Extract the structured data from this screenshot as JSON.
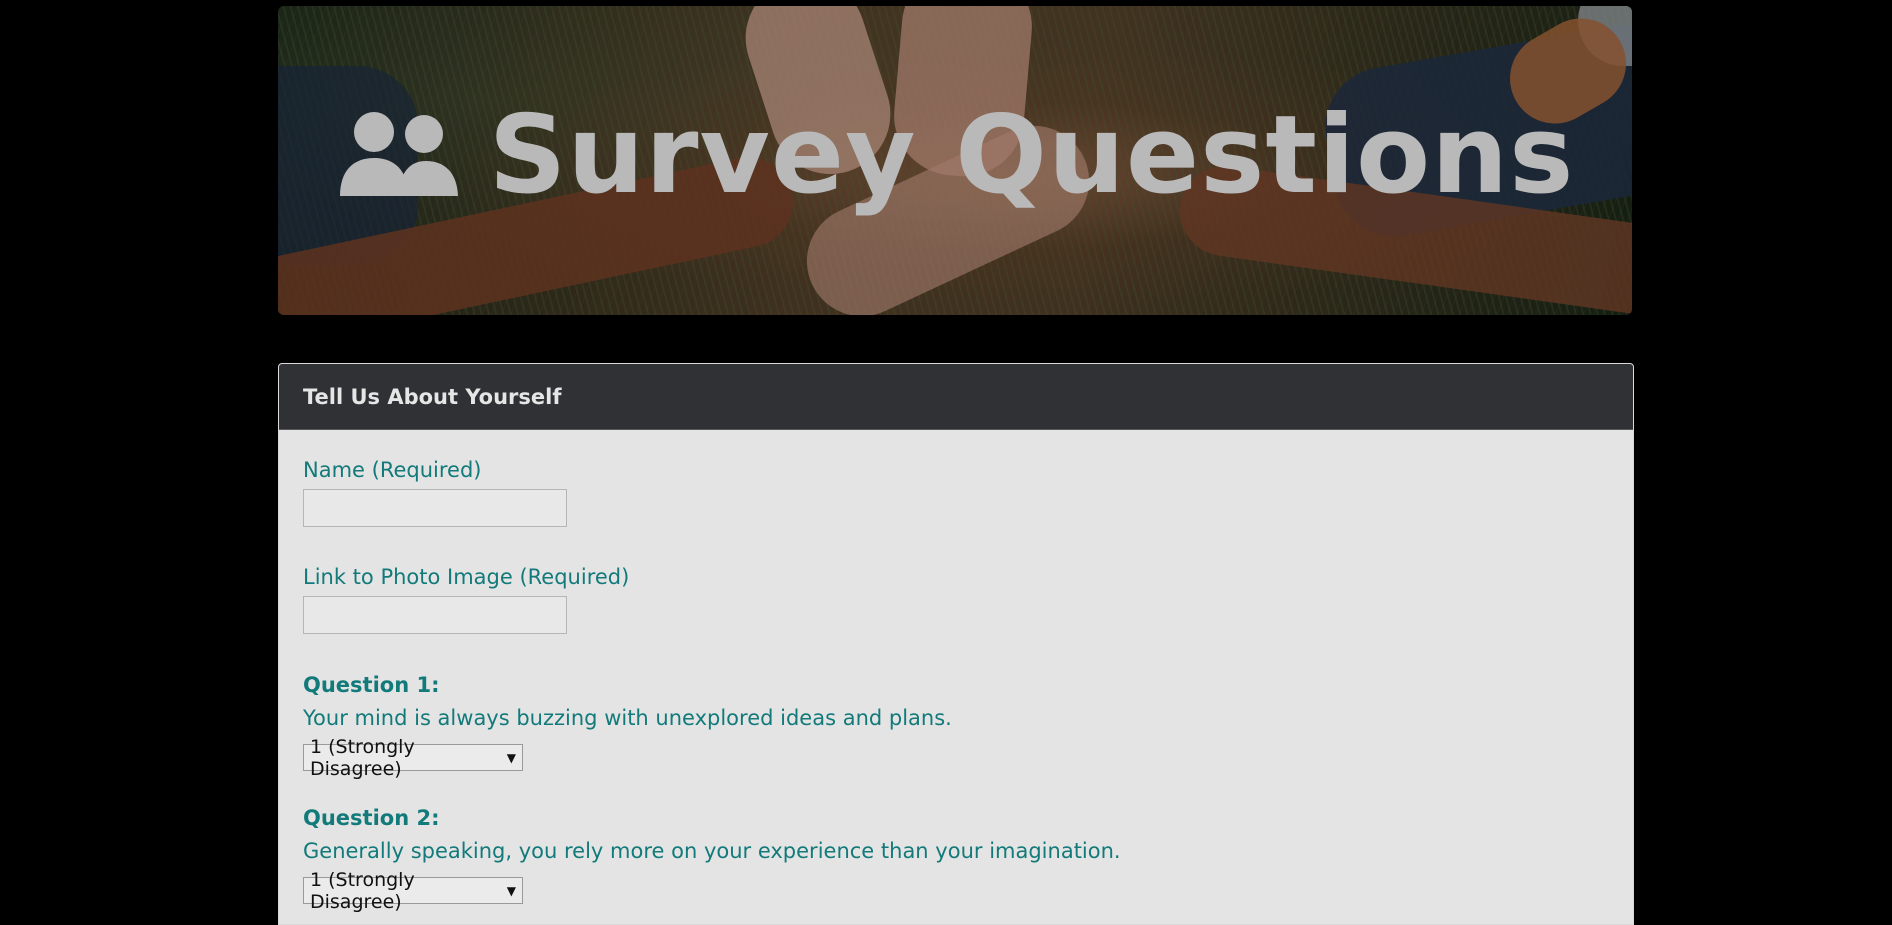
{
  "hero": {
    "title": "Survey Questions",
    "icon": "users-icon"
  },
  "form": {
    "header": "Tell Us About Yourself",
    "fields": [
      {
        "label": "Name (Required)",
        "value": ""
      },
      {
        "label": "Link to Photo Image (Required)",
        "value": ""
      }
    ],
    "questions": [
      {
        "title": "Question 1:",
        "text": "Your mind is always buzzing with unexplored ideas and plans.",
        "selected": "1 (Strongly Disagree)"
      },
      {
        "title": "Question 2:",
        "text": "Generally speaking, you rely more on your experience than your imagination.",
        "selected": "1 (Strongly Disagree)"
      }
    ]
  },
  "colors": {
    "page_bg": "#000000",
    "panel_bg": "#e4e4e4",
    "header_bg": "#2f3135",
    "accent_text": "#127a7a",
    "hero_title": "#b9b9b9"
  }
}
